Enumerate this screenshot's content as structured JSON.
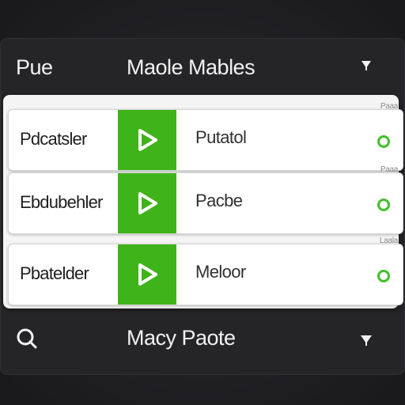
{
  "header": {
    "left_label": "Pue",
    "title": "Maole Mables",
    "menu_icon": "chevron-down-icon"
  },
  "rows": [
    {
      "name": "Pdcatsler",
      "track": "Putatol",
      "meta": "Paaa",
      "play_icon": "play-icon",
      "status_icon": "status-ring-icon"
    },
    {
      "name": "Ebdubehler",
      "track": "Pacbe",
      "meta": "Paaa",
      "play_icon": "play-icon",
      "status_icon": "status-ring-icon"
    },
    {
      "name": "Pbatelder",
      "track": "Meloor",
      "meta": "Laala",
      "play_icon": "play-icon",
      "status_icon": "status-ring-icon"
    }
  ],
  "footer": {
    "search_icon": "search-icon",
    "title": "Macy Paote",
    "menu_icon": "chevron-down-icon"
  },
  "colors": {
    "accent_green": "#3fb31a",
    "status_green": "#43c02b",
    "panel_dark": "#252528",
    "card_light": "#ffffff"
  }
}
